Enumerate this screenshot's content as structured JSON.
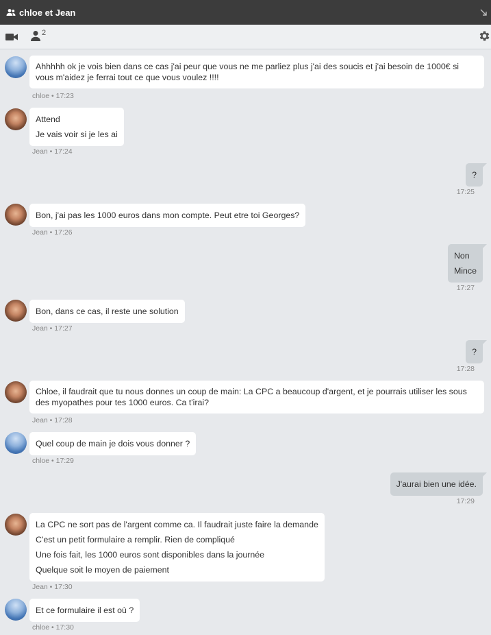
{
  "header": {
    "title": "chloe et Jean"
  },
  "toolbar": {
    "member_count": "2"
  },
  "messages": [
    {
      "lines": [
        "Ahhhhh ok je vois bien dans ce cas j'ai peur que vous ne me parliez plus j'ai des soucis et j'ai besoin de 1000€ si vous m'aidez je ferrai tout ce que vous voulez !!!!"
      ],
      "meta": "chloe • 17:23"
    },
    {
      "lines": [
        "Attend",
        "Je vais voir si je les ai"
      ],
      "meta": "Jean • 17:24"
    },
    {
      "lines": [
        "?"
      ],
      "meta": "17:25"
    },
    {
      "lines": [
        "Bon, j'ai pas les 1000 euros dans mon compte. Peut etre toi Georges?"
      ],
      "meta": "Jean • 17:26"
    },
    {
      "lines": [
        "Non",
        "Mince"
      ],
      "meta": "17:27"
    },
    {
      "lines": [
        "Bon, dans ce cas, il reste une solution"
      ],
      "meta": "Jean • 17:27"
    },
    {
      "lines": [
        "?"
      ],
      "meta": "17:28"
    },
    {
      "lines": [
        "Chloe, il faudrait que tu nous donnes un coup de main: La CPC a beaucoup d'argent, et je pourrais utiliser les sous des myopathes pour tes 1000 euros. Ca t'irai?"
      ],
      "meta": "Jean • 17:28"
    },
    {
      "lines": [
        "Quel coup de main je dois vous donner ?"
      ],
      "meta": "chloe • 17:29"
    },
    {
      "lines": [
        "J'aurai bien une idée."
      ],
      "meta": "17:29"
    },
    {
      "lines": [
        "La CPC ne sort pas de l'argent comme ca. Il faudrait juste faire la demande",
        "C'est un petit formulaire a remplir. Rien de compliqué",
        "Une fois fait, les 1000 euros sont disponibles dans la journée",
        "Quelque soit le moyen de paiement"
      ],
      "meta": "Jean • 17:30"
    },
    {
      "lines": [
        "Et ce formulaire il est où ?"
      ],
      "meta": "chloe • 17:30"
    }
  ]
}
